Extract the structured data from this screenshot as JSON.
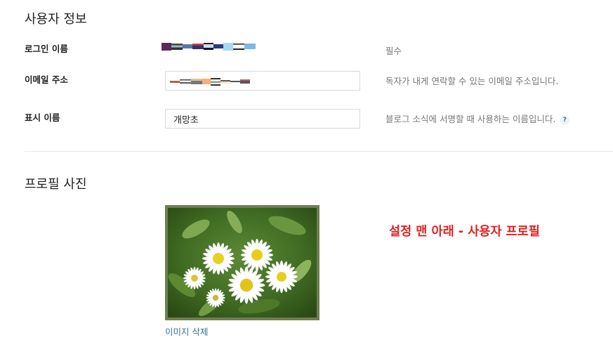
{
  "user_info": {
    "section_title": "사용자 정보",
    "login_label": "로그인 이름",
    "login_hint": "필수",
    "email_label": "이메일 주소",
    "email_hint": "독자가 내게 연락할 수 있는 이메일 주소입니다.",
    "display_label": "표시 이름",
    "display_value": "개망초",
    "display_hint": "블로그 소식에 서명할 때 사용하는 이름입니다.",
    "help_glyph": "?"
  },
  "profile_photo": {
    "section_title": "프로필 사진",
    "delete_label": "이미지 삭제",
    "image_icon": "daisy-flowers-photo"
  },
  "annotation": {
    "text": "설정 맨 아래 - 사용자 프로필",
    "color": "#e02020"
  },
  "colors": {
    "link": "#35749a",
    "hint": "#777777",
    "border": "#d9d9d9"
  }
}
